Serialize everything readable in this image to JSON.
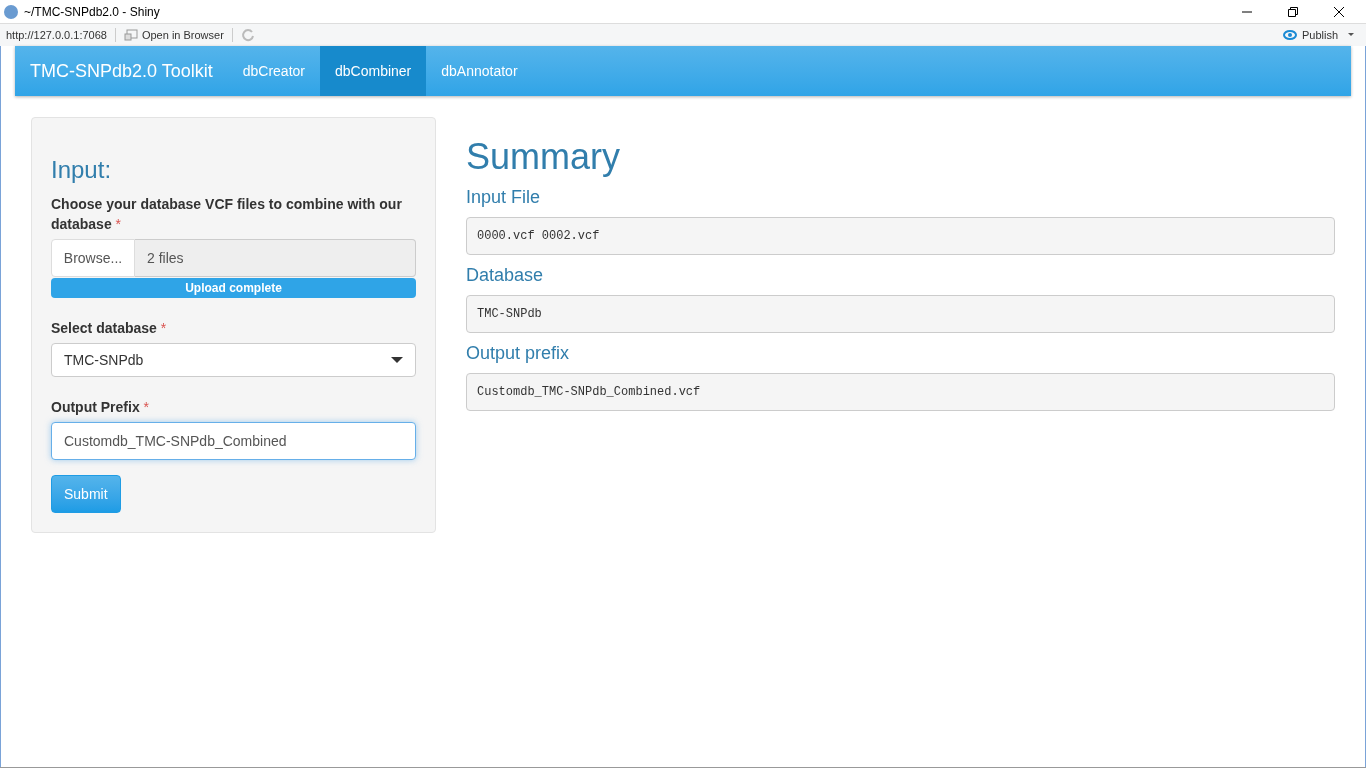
{
  "window": {
    "title": "~/TMC-SNPdb2.0 - Shiny"
  },
  "toolbar": {
    "url": "http://127.0.0.1:7068",
    "open_in_browser": "Open in Browser",
    "publish": "Publish"
  },
  "navbar": {
    "brand": "TMC-SNPdb2.0 Toolkit",
    "tabs": [
      {
        "label": "dbCreator",
        "selected": false
      },
      {
        "label": "dbCombiner",
        "selected": true
      },
      {
        "label": "dbAnnotator",
        "selected": false
      }
    ]
  },
  "input_panel": {
    "title": "Input:",
    "file_input": {
      "label": "Choose your database VCF files to combine with our database",
      "required_mark": "*",
      "button": "Browse...",
      "value": "2 files",
      "progress": {
        "text": "Upload complete",
        "level": 1
      }
    },
    "select": {
      "label": "Select database",
      "required_mark": "*",
      "value": "TMC-SNPdb"
    },
    "prefix": {
      "label": "Output Prefix",
      "required_mark": "*",
      "value": "Customdb_TMC-SNPdb_Combined",
      "focused": true
    },
    "submit": "Submit"
  },
  "summary": {
    "title": "Summary",
    "sections": [
      {
        "heading": "Input File",
        "value": "0000.vcf 0002.vcf"
      },
      {
        "heading": "Database",
        "value": "TMC-SNPdb"
      },
      {
        "heading": "Output prefix",
        "value": "Customdb_TMC-SNPdb_Combined.vcf"
      }
    ]
  }
}
